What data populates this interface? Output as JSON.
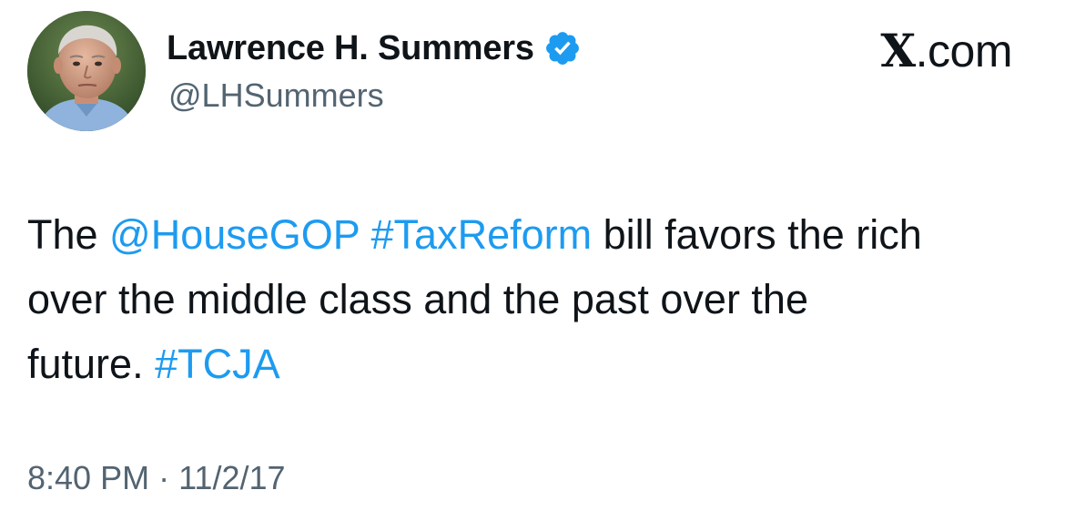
{
  "author": {
    "display_name": "Lawrence H. Summers",
    "handle": "@LHSummers",
    "verified": true,
    "avatar_icon": "profile-photo"
  },
  "brand": {
    "glyph": "X",
    "suffix": ".com"
  },
  "tweet": {
    "segments": [
      {
        "text": "The ",
        "type": "text"
      },
      {
        "text": "@HouseGOP",
        "type": "mention"
      },
      {
        "text": " ",
        "type": "text"
      },
      {
        "text": "#TaxReform",
        "type": "hashtag"
      },
      {
        "text": " bill favors the rich\nover the middle class and the past over the\nfuture.  ",
        "type": "text"
      },
      {
        "text": "#TCJA",
        "type": "hashtag"
      }
    ]
  },
  "meta": {
    "time": "8:40 PM",
    "separator": " · ",
    "date": "11/2/17"
  },
  "colors": {
    "link": "#1d9bf0",
    "secondary_text": "#536471",
    "primary_text": "#0f1419",
    "verified_badge": "#1d9bf0"
  }
}
